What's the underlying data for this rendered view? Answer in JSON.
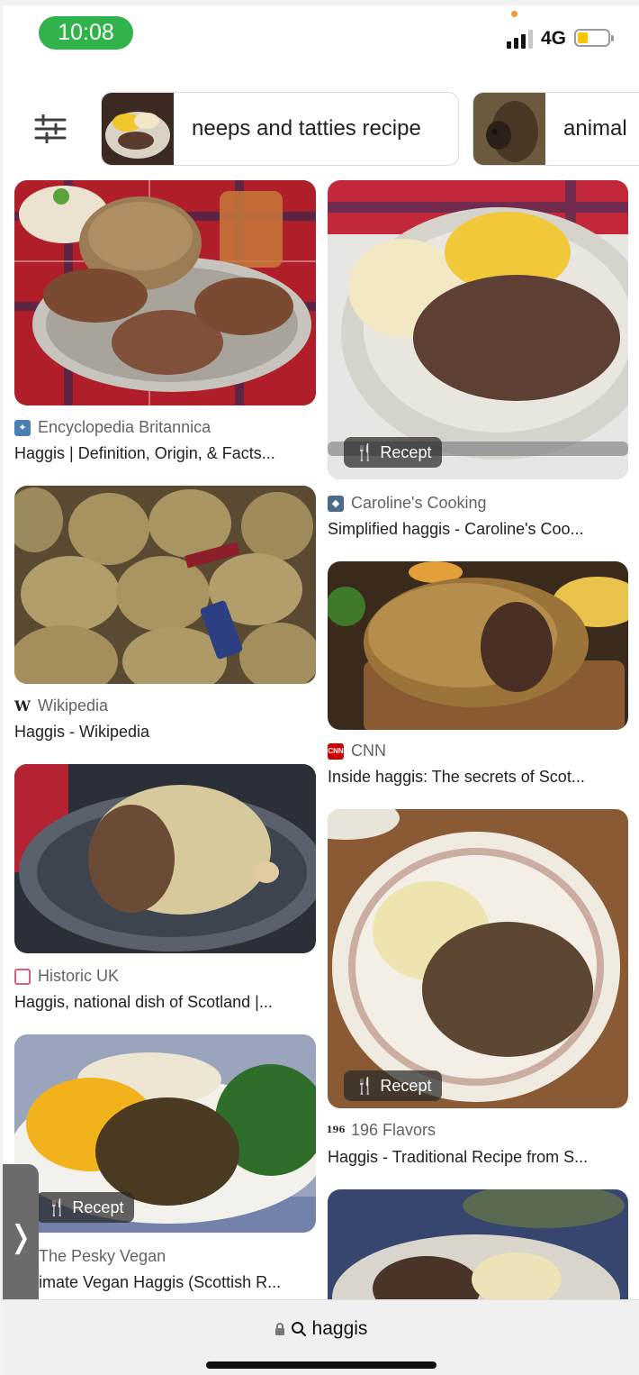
{
  "status_bar": {
    "time": "10:08",
    "network": "4G",
    "battery_level": 0.25
  },
  "chips": [
    {
      "label": "neeps and tatties recipe"
    },
    {
      "label": "animal"
    }
  ],
  "results": [
    {
      "source": "Encyclopedia Britannica",
      "title": "Haggis | Definition, Origin, & Facts...",
      "badge": "",
      "favicon": "britannica-favicon"
    },
    {
      "source": "Caroline's Cooking",
      "title": "Simplified haggis - Caroline's Coo...",
      "badge": "Recept",
      "favicon": "carolines-cooking-favicon"
    },
    {
      "source": "Wikipedia",
      "title": "Haggis - Wikipedia",
      "badge": "",
      "favicon": "wikipedia-favicon",
      "favicon_text": "W"
    },
    {
      "source": "CNN",
      "title": "Inside haggis: The secrets of Scot...",
      "badge": "",
      "favicon": "cnn-favicon",
      "favicon_text": "CNN"
    },
    {
      "source": "Historic UK",
      "title": "Haggis, national dish of Scotland |...",
      "badge": "",
      "favicon": "historic-uk-favicon"
    },
    {
      "source": "196 Flavors",
      "title": "Haggis - Traditional Recipe from S...",
      "badge": "Recept",
      "favicon": "196-flavors-favicon",
      "favicon_text": "196"
    },
    {
      "source": "The Pesky Vegan",
      "title": "imate Vegan Haggis (Scottish R...",
      "badge": "Recept",
      "favicon": ""
    }
  ],
  "side_tab": {
    "glyph": "❭"
  },
  "url_bar": {
    "query": "haggis"
  },
  "colors": {
    "clock_pill": "#2fb34a",
    "battery": "#f6c500",
    "cnn_red": "#cc0000"
  }
}
